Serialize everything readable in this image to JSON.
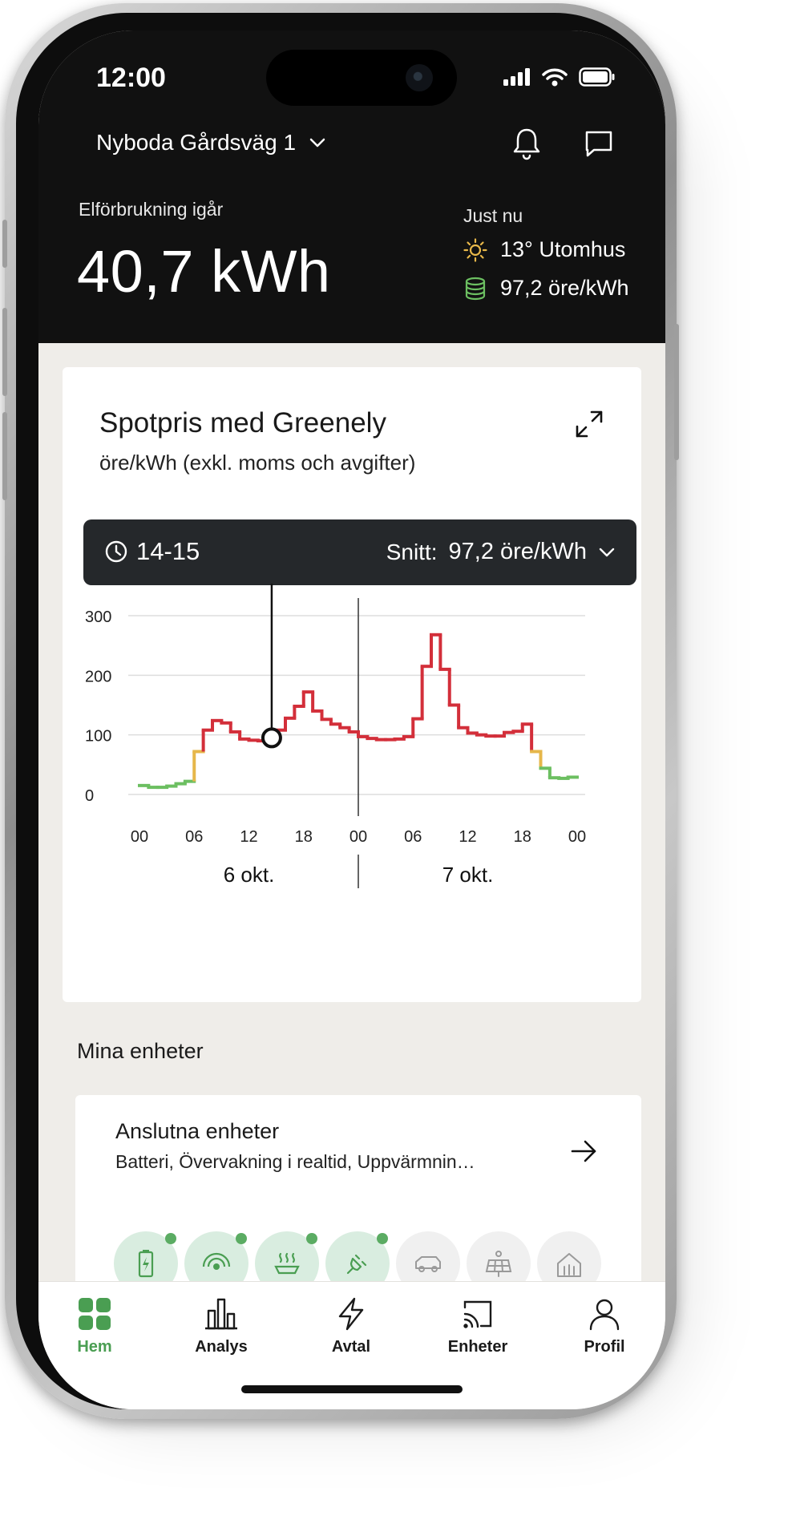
{
  "status_bar": {
    "time": "12:00"
  },
  "header": {
    "address": "Nyboda Gårdsväg 1",
    "consumption_label": "Elförbrukning igår",
    "consumption_value": "40,7 kWh",
    "now_label": "Just nu",
    "temperature": "13° Utomhus",
    "price_now": "97,2 öre/kWh"
  },
  "spot_card": {
    "title": "Spotpris med Greenely",
    "subtitle": "öre/kWh (exkl. moms och avgifter)",
    "tooltip_hour": "14-15",
    "avg_label": "Snitt:",
    "avg_value": "97,2 öre/kWh",
    "day1": "6 okt.",
    "day2": "7 okt."
  },
  "chart_data": {
    "type": "line",
    "step": true,
    "x": [
      0,
      1,
      2,
      3,
      4,
      5,
      6,
      7,
      8,
      9,
      10,
      11,
      12,
      13,
      14,
      15,
      16,
      17,
      18,
      19,
      20,
      21,
      22,
      23,
      24,
      25,
      26,
      27,
      28,
      29,
      30,
      31,
      32,
      33,
      34,
      35,
      36,
      37,
      38,
      39,
      40,
      41,
      42,
      43,
      44,
      45,
      46,
      47
    ],
    "values": [
      15,
      12,
      12,
      14,
      18,
      22,
      72,
      108,
      124,
      120,
      105,
      93,
      91,
      90,
      95,
      108,
      128,
      148,
      172,
      140,
      126,
      118,
      112,
      105,
      97,
      94,
      92,
      92,
      93,
      97,
      127,
      215,
      268,
      210,
      150,
      112,
      103,
      100,
      98,
      98,
      104,
      106,
      118,
      72,
      44,
      28,
      27,
      29
    ],
    "x_ticks": [
      "00",
      "06",
      "12",
      "18",
      "00",
      "06",
      "12",
      "18",
      "00"
    ],
    "y_ticks": [
      "0",
      "100",
      "200",
      "300"
    ],
    "ylim": [
      0,
      300
    ],
    "selected_hour": 14,
    "colors": {
      "high": "#d32f3a",
      "mid": "#e6b74a",
      "low": "#6cbf61"
    }
  },
  "devices": {
    "section_title": "Mina enheter",
    "card_title": "Anslutna enheter",
    "card_subtitle": "Batteri, Övervakning i realtid, Uppvärmnin…",
    "icons": [
      {
        "icon": "battery-icon",
        "connected": true
      },
      {
        "icon": "monitor-icon",
        "connected": true
      },
      {
        "icon": "heating-icon",
        "connected": true
      },
      {
        "icon": "ev-charger-icon",
        "connected": true
      },
      {
        "icon": "car-icon",
        "connected": false
      },
      {
        "icon": "solar-panel-icon",
        "connected": false
      },
      {
        "icon": "house-heatpump-icon",
        "connected": false
      }
    ]
  },
  "tabbar": {
    "home": "Hem",
    "analysis": "Analys",
    "contract": "Avtal",
    "devices": "Enheter",
    "profile": "Profil",
    "active_color": "#4a9e52"
  }
}
